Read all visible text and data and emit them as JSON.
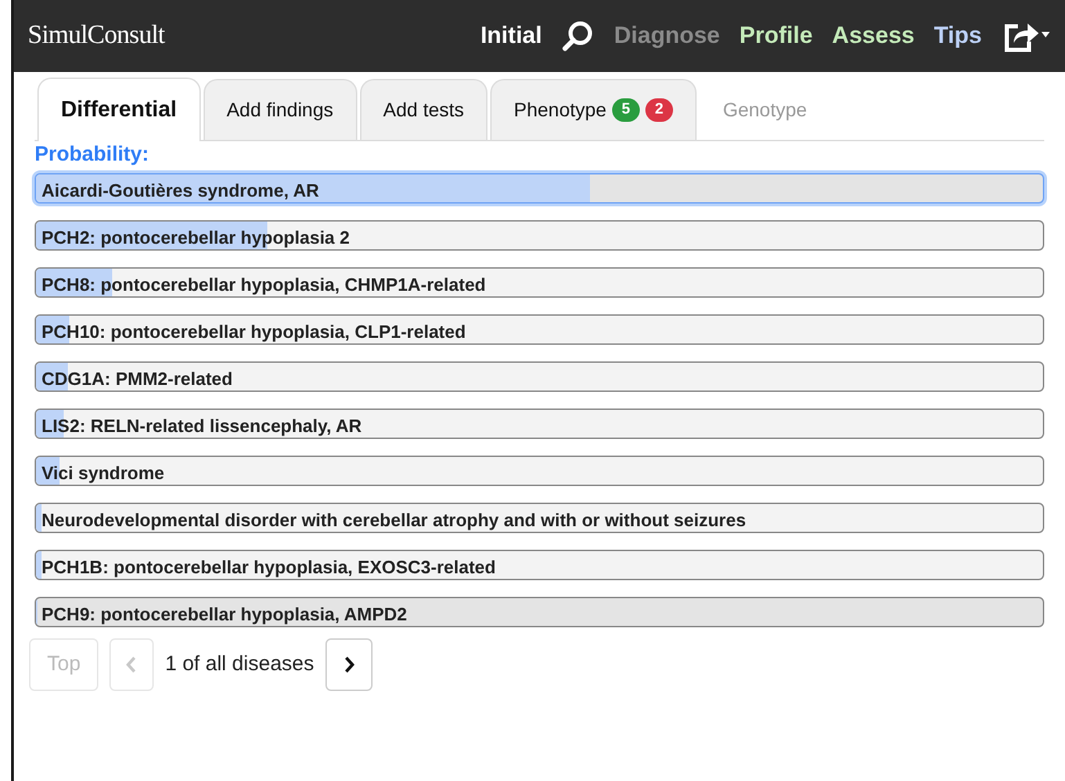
{
  "header": {
    "logo": "SimulConsult",
    "nav": [
      {
        "label": "Initial",
        "color": "#ffffff"
      },
      {
        "label": "Diagnose",
        "color": "#8a8a8a"
      },
      {
        "label": "Profile",
        "color": "#c4eab9"
      },
      {
        "label": "Assess",
        "color": "#c4eab9"
      },
      {
        "label": "Tips",
        "color": "#bcd0f5"
      }
    ]
  },
  "tabs": [
    {
      "label": "Differential",
      "selected": true,
      "disabled": false
    },
    {
      "label": "Add findings",
      "selected": false,
      "disabled": false
    },
    {
      "label": "Add tests",
      "selected": false,
      "disabled": false
    },
    {
      "label": "Phenotype",
      "selected": false,
      "disabled": false,
      "badges": [
        {
          "text": "5",
          "color": "#2a9d3f"
        },
        {
          "text": "2",
          "color": "#dc3545"
        }
      ]
    },
    {
      "label": "Genotype",
      "selected": false,
      "disabled": true
    }
  ],
  "section_label": "Probability:",
  "diseases": [
    {
      "name": "Aicardi-Goutières syndrome, AR",
      "level": 0.55,
      "selected": true,
      "hovered": false
    },
    {
      "name": "PCH2: pontocerebellar hypoplasia 2",
      "level": 0.23,
      "selected": false,
      "hovered": false
    },
    {
      "name": "PCH8: pontocerebellar hypoplasia, CHMP1A-related",
      "level": 0.076,
      "selected": false,
      "hovered": false
    },
    {
      "name": "PCH10: pontocerebellar hypoplasia, CLP1-related",
      "level": 0.033,
      "selected": false,
      "hovered": false
    },
    {
      "name": "CDG1A: PMM2-related",
      "level": 0.031,
      "selected": false,
      "hovered": false
    },
    {
      "name": "LIS2: RELN-related lissencephaly, AR",
      "level": 0.027,
      "selected": false,
      "hovered": false
    },
    {
      "name": "Vici syndrome",
      "level": 0.023,
      "selected": false,
      "hovered": false
    },
    {
      "name": "Neurodevelopmental disorder with cerebellar atrophy and with or without seizures",
      "level": 0.006,
      "selected": false,
      "hovered": false
    },
    {
      "name": "PCH1B: pontocerebellar hypoplasia, EXOSC3-related",
      "level": 0.005,
      "selected": false,
      "hovered": false
    },
    {
      "name": "PCH9: pontocerebellar hypoplasia, AMPD2",
      "level": 0,
      "selected": false,
      "hovered": true
    }
  ],
  "pager": {
    "top": {
      "label": "Top",
      "disabled": true
    },
    "prev": {
      "disabled": true
    },
    "status": "1 of all diseases",
    "next": {
      "disabled": false
    }
  }
}
